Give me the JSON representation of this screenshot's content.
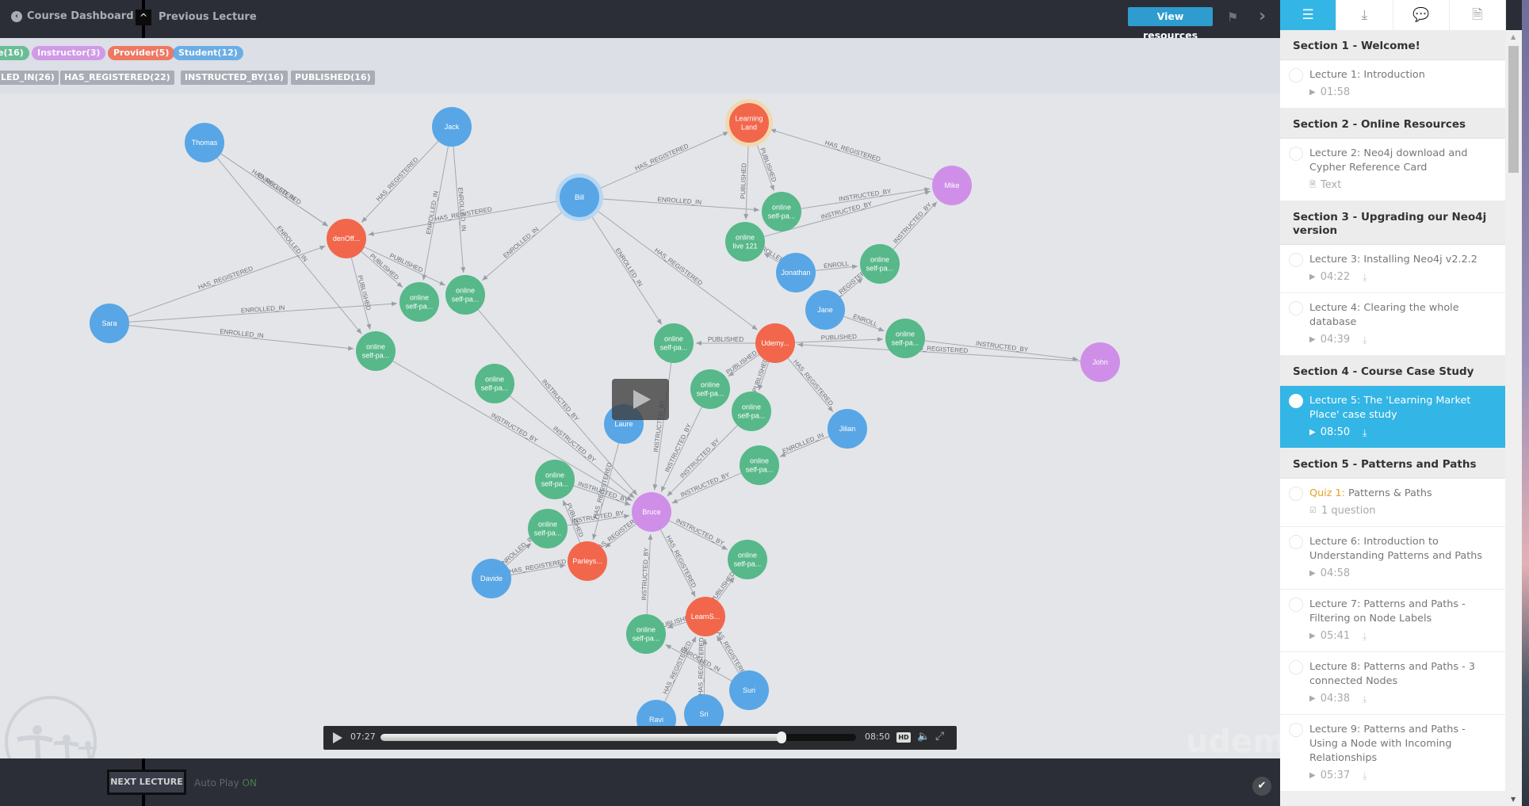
{
  "header": {
    "course_dashboard": "Course Dashboard",
    "previous_lecture": "Previous Lecture",
    "view_resources": "View resources"
  },
  "graph": {
    "node_labels": [
      {
        "text": "e(16)",
        "color": "#57b889"
      },
      {
        "text": "Instructor(3)",
        "color": "#cf8fe8"
      },
      {
        "text": "Provider(5)",
        "color": "#f2674c"
      },
      {
        "text": "Student(12)",
        "color": "#58a6e6"
      }
    ],
    "relationship_types": [
      "LED_IN(26)",
      "HAS_REGISTERED(22)",
      "INSTRUCTED_BY(16)",
      "PUBLISHED(16)"
    ],
    "colors": {
      "student": "#58a6e6",
      "instructor": "#cf8fe8",
      "provider": "#f2674c",
      "course": "#57b889"
    },
    "nodes": [
      {
        "id": "thomas",
        "label": "Thomas",
        "type": "student"
      },
      {
        "id": "jack",
        "label": "Jack",
        "type": "student"
      },
      {
        "id": "bill",
        "label": "Bill",
        "type": "student"
      },
      {
        "id": "sara",
        "label": "Sara",
        "type": "student"
      },
      {
        "id": "jonathan",
        "label": "Jonathan",
        "type": "student"
      },
      {
        "id": "jane",
        "label": "Jane",
        "type": "student"
      },
      {
        "id": "jilian",
        "label": "Jilian",
        "type": "student"
      },
      {
        "id": "laure",
        "label": "Laure",
        "type": "student"
      },
      {
        "id": "davide",
        "label": "Davide",
        "type": "student"
      },
      {
        "id": "suri",
        "label": "Suri",
        "type": "student"
      },
      {
        "id": "ravi",
        "label": "Ravi",
        "type": "student"
      },
      {
        "id": "sri",
        "label": "Sri",
        "type": "student"
      },
      {
        "id": "mike",
        "label": "Mike",
        "type": "instructor"
      },
      {
        "id": "john",
        "label": "John",
        "type": "instructor"
      },
      {
        "id": "bruce",
        "label": "Bruce",
        "type": "instructor"
      },
      {
        "id": "learningland",
        "label": "Learning Land",
        "type": "provider"
      },
      {
        "id": "denoff",
        "label": "denOff...",
        "type": "provider"
      },
      {
        "id": "udemy",
        "label": "Udemy...",
        "type": "provider"
      },
      {
        "id": "pariesys",
        "label": "Parleys...",
        "type": "provider"
      },
      {
        "id": "learns",
        "label": "LearnS...",
        "type": "provider"
      },
      {
        "id": "c1",
        "label": "online self-pa...",
        "type": "course"
      },
      {
        "id": "c2",
        "label": "online self-pa...",
        "type": "course"
      },
      {
        "id": "c3",
        "label": "online self-pa...",
        "type": "course"
      },
      {
        "id": "c4",
        "label": "online self-pa...",
        "type": "course"
      },
      {
        "id": "c5",
        "label": "online self-pa...",
        "type": "course"
      },
      {
        "id": "c6",
        "label": "online live 121",
        "type": "course"
      },
      {
        "id": "c7",
        "label": "online self-pa...",
        "type": "course"
      },
      {
        "id": "c8",
        "label": "online self-pa...",
        "type": "course"
      },
      {
        "id": "c9",
        "label": "online self-pa...",
        "type": "course"
      },
      {
        "id": "c10",
        "label": "online self-pa...",
        "type": "course"
      },
      {
        "id": "c11",
        "label": "online self-pa...",
        "type": "course"
      },
      {
        "id": "c12",
        "label": "online self-pa...",
        "type": "course"
      },
      {
        "id": "c13",
        "label": "online self-pa...",
        "type": "course"
      },
      {
        "id": "c14",
        "label": "online self-pa...",
        "type": "course"
      },
      {
        "id": "c15",
        "label": "online self-pa...",
        "type": "course"
      },
      {
        "id": "c16",
        "label": "online self-pa...",
        "type": "course"
      },
      {
        "id": "c17",
        "label": "online self-pa...",
        "type": "course"
      }
    ],
    "edges": [
      [
        "thomas",
        "denoff",
        "HAS_REGISTERED"
      ],
      [
        "thomas",
        "denoff",
        "ENROLLED_IN"
      ],
      [
        "thomas",
        "c3",
        "ENROLLED_IN"
      ],
      [
        "jack",
        "denoff",
        "HAS_REGISTERED"
      ],
      [
        "jack",
        "c1",
        "ENROLLED_IN"
      ],
      [
        "jack",
        "c2",
        "ENROLLED_IN"
      ],
      [
        "bill",
        "denoff",
        "HAS_REGISTERED"
      ],
      [
        "bill",
        "c2",
        "ENROLLED_IN"
      ],
      [
        "bill",
        "learningland",
        "HAS_REGISTERED"
      ],
      [
        "bill",
        "c5",
        "ENROLLED_IN"
      ],
      [
        "bill",
        "c8",
        "ENROLLED_IN"
      ],
      [
        "bill",
        "udemy",
        "HAS_REGISTERED"
      ],
      [
        "sara",
        "denoff",
        "HAS_REGISTERED"
      ],
      [
        "sara",
        "c1",
        "ENROLLED_IN"
      ],
      [
        "sara",
        "c3",
        "ENROLLED_IN"
      ],
      [
        "denoff",
        "c1",
        "PUBLISHED"
      ],
      [
        "denoff",
        "c2",
        "PUBLISHED"
      ],
      [
        "denoff",
        "c3",
        "PUBLISHED"
      ],
      [
        "learningland",
        "c5",
        "PUBLISHED"
      ],
      [
        "learningland",
        "c6",
        "PUBLISHED"
      ],
      [
        "mike",
        "learningland",
        "HAS_REGISTERED"
      ],
      [
        "c5",
        "mike",
        "INSTRUCTED_BY"
      ],
      [
        "c6",
        "mike",
        "INSTRUCTED_BY"
      ],
      [
        "c7",
        "mike",
        "INSTRUCTED_BY"
      ],
      [
        "jonathan",
        "c7",
        "ENROLL"
      ],
      [
        "jane",
        "c9",
        "ENROLL"
      ],
      [
        "udemy",
        "c8",
        "PUBLISHED"
      ],
      [
        "udemy",
        "c9",
        "PUBLISHED"
      ],
      [
        "c9",
        "john",
        "INSTRUCTED_BY"
      ],
      [
        "john",
        "udemy",
        "HAS_REGISTERED"
      ],
      [
        "jilian",
        "c12",
        "ENROLLED_IN"
      ],
      [
        "udemy",
        "jilian",
        "HAS_REGISTERED"
      ],
      [
        "c4",
        "bruce",
        "INSTRUCTED_BY"
      ],
      [
        "c3",
        "bruce",
        "INSTRUCTED_BY"
      ],
      [
        "c10",
        "bruce",
        "INSTRUCTED_BY"
      ],
      [
        "c11",
        "bruce",
        "INSTRUCTED_BY"
      ],
      [
        "c12",
        "bruce",
        "INSTRUCTED_BY"
      ],
      [
        "c13",
        "bruce",
        "INSTRUCTED_BY"
      ],
      [
        "c14",
        "bruce",
        "INSTRUCTED_BY"
      ],
      [
        "c8",
        "bruce",
        "INSTRUCTED_BY"
      ],
      [
        "c2",
        "bruce",
        "INSTRUCTED_BY"
      ],
      [
        "bruce",
        "c16",
        "INSTRUCTED_BY"
      ],
      [
        "bruce",
        "pariesys",
        "HAS_REGISTERED"
      ],
      [
        "bruce",
        "learns",
        "HAS_REGISTERED"
      ],
      [
        "c17",
        "bruce",
        "INSTRUCTED_BY"
      ],
      [
        "davide",
        "pariesys",
        "HAS_REGISTERED"
      ],
      [
        "davide",
        "c14",
        "ENROLLED_IN"
      ],
      [
        "pariesys",
        "c13",
        "PUBLISHED"
      ],
      [
        "learns",
        "c16",
        "PUBLISHED"
      ],
      [
        "learns",
        "c17",
        "PUBLISHED"
      ],
      [
        "suri",
        "learns",
        "HAS_REGISTERED"
      ],
      [
        "sri",
        "learns",
        "HAS_REGISTERED"
      ],
      [
        "ravi",
        "learns",
        "HAS_REGISTERED"
      ],
      [
        "suri",
        "c17",
        "ENROLLED_IN"
      ],
      [
        "laure",
        "pariesys",
        "HAS_REGISTERED"
      ],
      [
        "jonathan",
        "c6",
        "ENROLLED_IN"
      ],
      [
        "jane",
        "c7",
        "HAS_REGISTERED"
      ],
      [
        "udemy",
        "c10",
        "PUBLISHED"
      ],
      [
        "udemy",
        "c11",
        "PUBLISHED"
      ]
    ]
  },
  "player": {
    "current_time": "07:27",
    "duration": "08:50",
    "progress": 0.843,
    "hd_label": "HD",
    "watermark": "udemy"
  },
  "footer": {
    "next_lecture": "NEXT LECTURE",
    "auto_play_label": "Auto Play",
    "auto_play_state": "ON"
  },
  "sidebar": {
    "tabs": [
      {
        "name": "curriculum",
        "icon": "☰"
      },
      {
        "name": "downloads",
        "icon": "⤓"
      },
      {
        "name": "discussions",
        "icon": "💬"
      },
      {
        "name": "notes",
        "icon": "🗎"
      }
    ],
    "sections": [
      {
        "title": "Section 1 - Welcome!",
        "items": [
          {
            "title": "Lecture 1: Introduction",
            "meta": "01:58",
            "kind": "video",
            "download": false
          }
        ]
      },
      {
        "title": "Section 2 - Online Resources",
        "items": [
          {
            "title": "Lecture 2: Neo4j download and Cypher Reference Card",
            "meta": "Text",
            "kind": "text",
            "download": false
          }
        ]
      },
      {
        "title": "Section 3 - Upgrading our Neo4j version",
        "items": [
          {
            "title": "Lecture 3: Installing Neo4j v2.2.2",
            "meta": "04:22",
            "kind": "video",
            "download": true
          },
          {
            "title": "Lecture 4: Clearing the whole database",
            "meta": "04:39",
            "kind": "video",
            "download": true
          }
        ]
      },
      {
        "title": "Section 4 - Course Case Study",
        "items": [
          {
            "title": "Lecture 5: The 'Learning Market Place' case study",
            "meta": "08:50",
            "kind": "video",
            "download": true,
            "active": true
          }
        ]
      },
      {
        "title": "Section 5 - Patterns and Paths",
        "items": [
          {
            "prefix": "Quiz 1:",
            "title": "Patterns & Paths",
            "meta": "1 question",
            "kind": "quiz",
            "download": false
          },
          {
            "title": "Lecture 6: Introduction to Understanding Patterns and Paths",
            "meta": "04:58",
            "kind": "video",
            "download": false
          },
          {
            "title": "Lecture 7: Patterns and Paths - Filtering on Node Labels",
            "meta": "05:41",
            "kind": "video",
            "download": true
          },
          {
            "title": "Lecture 8: Patterns and Paths - 3 connected Nodes",
            "meta": "04:38",
            "kind": "video",
            "download": true
          },
          {
            "title": "Lecture 9: Patterns and Paths - Using a Node with Incoming Relationships",
            "meta": "05:37",
            "kind": "video",
            "download": true
          }
        ]
      }
    ]
  }
}
